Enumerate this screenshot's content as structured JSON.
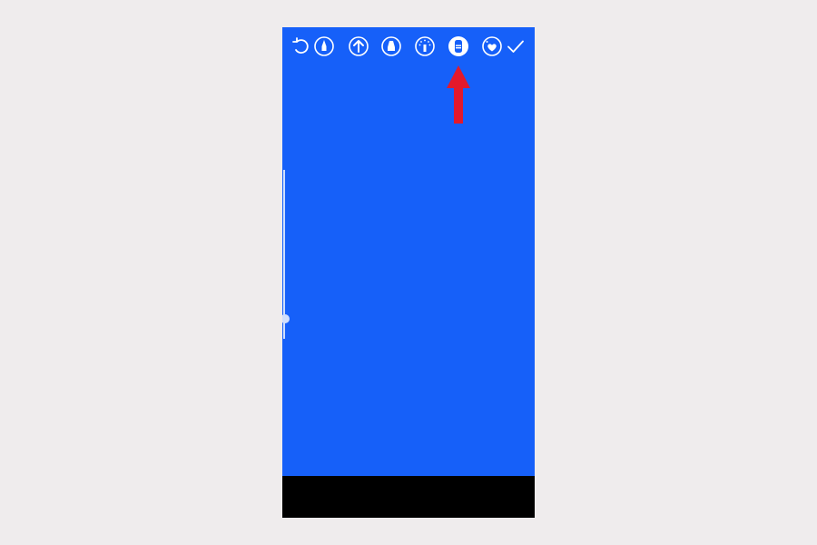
{
  "colors": {
    "page_background": "#efeced",
    "canvas": "#1660f9",
    "bottom_bar": "#000000",
    "icon": "#ffffff",
    "annotation_arrow": "#e3192c"
  },
  "toolbar": {
    "tools": [
      {
        "id": "undo",
        "icon": "undo-icon"
      },
      {
        "id": "t1",
        "icon": "pen-icon"
      },
      {
        "id": "t2",
        "icon": "arrow-pen-icon"
      },
      {
        "id": "t3",
        "icon": "marker-icon"
      },
      {
        "id": "t4",
        "icon": "glow-pen-icon"
      },
      {
        "id": "t5",
        "icon": "eraser-icon",
        "selected": true
      },
      {
        "id": "t6",
        "icon": "sticker-icon"
      },
      {
        "id": "done",
        "icon": "checkmark-icon"
      }
    ]
  },
  "brush_size": {
    "level": 0.88
  },
  "annotation": {
    "type": "red-arrow",
    "points_to": "eraser-icon"
  }
}
